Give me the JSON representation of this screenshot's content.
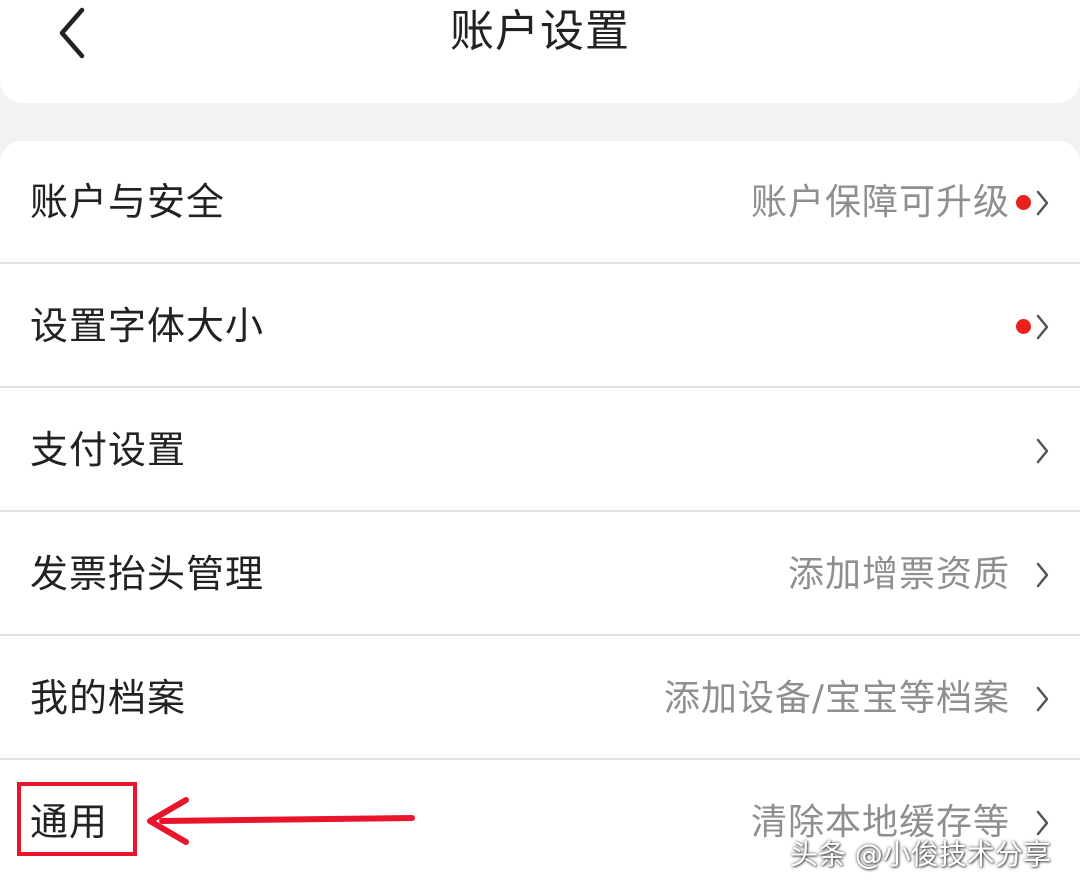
{
  "header": {
    "title": "账户设置",
    "back_icon": "chevron-left-icon"
  },
  "settings": {
    "rows": [
      {
        "label": "账户与安全",
        "hint": "账户保障可升级",
        "badge": true
      },
      {
        "label": "设置字体大小",
        "hint": "",
        "badge": true
      },
      {
        "label": "支付设置",
        "hint": "",
        "badge": false
      },
      {
        "label": "发票抬头管理",
        "hint": "添加增票资质",
        "badge": false
      },
      {
        "label": "我的档案",
        "hint": "添加设备/宝宝等档案",
        "badge": false
      },
      {
        "label": "通用",
        "hint": "清除本地缓存等",
        "badge": false
      }
    ]
  },
  "annotation": {
    "color": "#e8152c",
    "target": "通用"
  },
  "watermark": "头条 @小俊技术分享",
  "colors": {
    "badge": "#e8221a",
    "background": "#f2f2f2",
    "text": "#222222",
    "hint_text": "#8f8f8f"
  }
}
